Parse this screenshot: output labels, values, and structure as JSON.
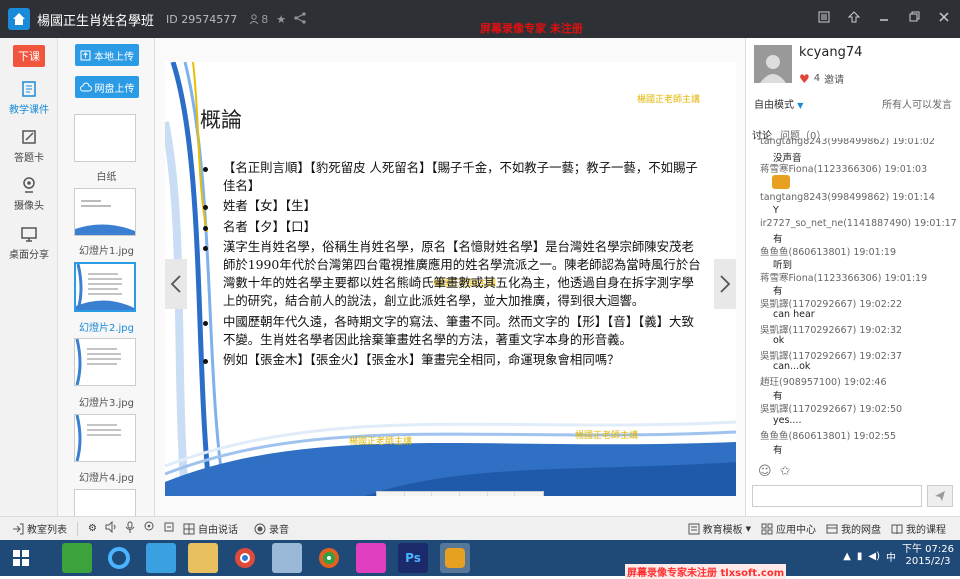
{
  "titlebar": {
    "title": "楊國正生肖姓名學班",
    "room_id": "ID 29574577",
    "member_count": "8",
    "watermark": "屏幕录像专家 未注册"
  },
  "leftnav": {
    "end_class": "下课",
    "items": [
      {
        "label": "教学课件",
        "icon": "courseware-icon"
      },
      {
        "label": "答题卡",
        "icon": "answer-card-icon"
      },
      {
        "label": "摄像头",
        "icon": "camera-icon"
      },
      {
        "label": "桌面分享",
        "icon": "desktop-share-icon"
      }
    ]
  },
  "thumbs": {
    "local_upload": "本地上传",
    "cloud_upload": "网盘上传",
    "items": [
      {
        "label": "白纸"
      },
      {
        "label": "幻燈片1.jpg"
      },
      {
        "label": "幻燈片2.jpg"
      },
      {
        "label": "幻燈片3.jpg"
      },
      {
        "label": "幻燈片4.jpg"
      }
    ]
  },
  "slide": {
    "title": "概論",
    "watermark": "楊國正老師主講",
    "bullets": [
      "【名正則言順】【豹死留皮 人死留名】【賜子千金，不如教子一藝；教子一藝，不如賜子佳名】",
      "姓者【女】【生】",
      "名者【夕】【口】",
      "漢字生肖姓名學，俗稱生肖姓名學，原名【名憶財姓名學】是台灣姓名學宗師陳安茂老師於1990年代於台灣第四台電視推廣應用的姓名學流派之一。陳老師認為當時風行於台灣數十年的姓名學主要都以姓名熊崎氏筆畫數或其五化為主，他透過自身在拆字測字學上的研究，結合前人的說法，創立此派姓名學，並大加推廣，得到很大迴響。",
      "中國歷朝年代久遠，各時期文字的寫法、筆畫不同。然而文字的【形】【音】【義】大致不變。生肖姓名學者因此捨棄筆畫姓名學的方法，著重文字本身的形音義。",
      "例如【張金木】【張金火】【張金水】筆畫完全相同，命運現象會相同嗎？"
    ]
  },
  "rightpanel": {
    "username": "kcyang74",
    "likes": "4",
    "invite": "邀请",
    "mode": "自由模式",
    "mode_right": "所有人可以发言",
    "tab_discuss": "讨论",
    "tab_question": "问题（0）",
    "messages": [
      {
        "header": "tangtang8243(998499862) 19:01:02",
        "body": "没声音"
      },
      {
        "header": "蒋雪寒Fiona(1123366306) 19:01:03",
        "body": ""
      },
      {
        "header": "tangtang8243(998499862) 19:01:14",
        "body": "Y"
      },
      {
        "header": "ir2727_so_net_ne(1141887490) 19:01:17",
        "body": "有"
      },
      {
        "header": "鱼鱼鱼(860613801) 19:01:19",
        "body": "听到"
      },
      {
        "header": "蒋雪寒Fiona(1123366306) 19:01:19",
        "body": "有"
      },
      {
        "header": "吳凱譯(1170292667) 19:02:22",
        "body": "can hear"
      },
      {
        "header": "吳凱譯(1170292667) 19:02:32",
        "body": "ok"
      },
      {
        "header": "吳凱譯(1170292667) 19:02:37",
        "body": "can...ok"
      },
      {
        "header": "趙玨(908957100) 19:02:46",
        "body": "有"
      },
      {
        "header": "吳凱譯(1170292667) 19:02:50",
        "body": "yes...."
      },
      {
        "header": "鱼鱼鱼(860613801) 19:02:55",
        "body": "有"
      }
    ]
  },
  "bottombar": {
    "room_list": "教室列表",
    "free_speech": "自由说话",
    "record": "录音",
    "edu_template": "教育模板",
    "app_center": "应用中心",
    "my_cloud": "我的网盘",
    "my_courses": "我的课程"
  },
  "taskbar": {
    "time": "下午 07:26",
    "date": "2015/2/3",
    "lang": "中",
    "watermark": "屏幕录像专家未注册 tlxsoft.com"
  }
}
